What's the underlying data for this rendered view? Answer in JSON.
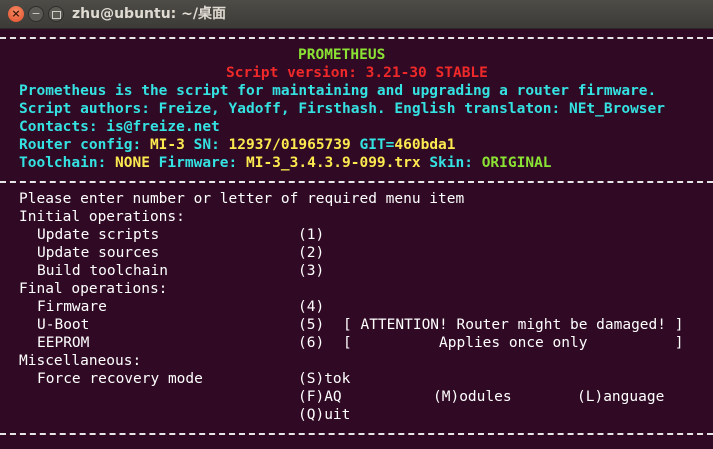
{
  "window": {
    "title": "zhu@ubuntu: ~/桌面",
    "close": "×",
    "min": "−"
  },
  "banner": {
    "name": "PROMETHEUS",
    "version": "Script version: 3.21-30 STABLE",
    "description": "Prometheus is the script for maintaining and upgrading a router firmware.",
    "authors": "Script authors: Freize, Yadoff, Firsthash. English translaton: NEt_Browser",
    "contacts": "Contacts: is@freize.net",
    "router_label": "Router config: ",
    "router_value": "MI-3",
    "sn_label": " SN: ",
    "sn_value": "12937/01965739",
    "git_label": " GIT=",
    "git_value": "460bda1",
    "toolchain_label": "Toolchain: ",
    "toolchain_value": "NONE",
    "firmware_label": " Firmware: ",
    "firmware_value": "MI-3_3.4.3.9-099.trx",
    "skin_label": " Skin: ",
    "skin_value": "ORIGINAL"
  },
  "menu": {
    "prompt": "Please enter number or letter of required menu item",
    "initial_header": "Initial operations:",
    "update_scripts": "Update scripts",
    "update_scripts_key": "(1)",
    "update_sources": "Update sources",
    "update_sources_key": "(2)",
    "build_toolchain": "Build toolchain",
    "build_toolchain_key": "(3)",
    "final_header": "Final operations:",
    "firmware": "Firmware",
    "firmware_key": "(4)",
    "uboot": "U-Boot",
    "uboot_key": "(5)",
    "uboot_note": "[ ATTENTION! Router might be damaged! ]",
    "eeprom": "EEPROM",
    "eeprom_key": "(6)",
    "eeprom_note": "[          Applies once only          ]",
    "misc_header": "Miscellaneous:",
    "force_recovery": "Force recovery mode",
    "stok": "(S)tok",
    "faq": "(F)AQ",
    "modules": "(M)odules",
    "language": "(L)anguage",
    "quit": "(Q)uit"
  }
}
